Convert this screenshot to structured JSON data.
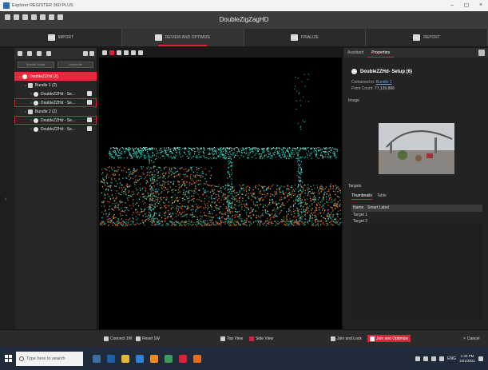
{
  "window": {
    "title": "Explorer REGISTER 360 PLUS",
    "min_label": "–",
    "max_label": "☐",
    "close_label": "×"
  },
  "header": {
    "doc_title": "DoubleZigZagHD"
  },
  "steps": [
    {
      "label": "IMPORT"
    },
    {
      "label": "REVIEW AND OPTIMIZE"
    },
    {
      "label": "FINALIZE"
    },
    {
      "label": "REPORT"
    }
  ],
  "project": {
    "btn_left": "Bundle Mode",
    "btn_right": "Unbundle",
    "tree": [
      {
        "label": "DoubleZZHd (2)",
        "level": 0,
        "type": "root",
        "selected": true
      },
      {
        "label": "Bundle 1 (2)",
        "level": 1,
        "type": "group"
      },
      {
        "label": "DoubleZZHd - Se... ",
        "level": 2,
        "type": "setup"
      },
      {
        "label": "DoubleZZHd - Se... ",
        "level": 2,
        "type": "setup",
        "outlined": true
      },
      {
        "label": "Bundle 2 (2)",
        "level": 1,
        "type": "group"
      },
      {
        "label": "DoubleZZHd - Se... ",
        "level": 2,
        "type": "setup",
        "outlined": true
      },
      {
        "label": "DoubleZZHd - Se... ",
        "level": 2,
        "type": "setup"
      }
    ]
  },
  "properties": {
    "tab_assistant": "Assistant",
    "tab_properties": "Properties",
    "setup_title": "DoubleZZHd- Setup (6)",
    "contained_in_label": "Contained in:",
    "contained_in_value": "Bundle 1",
    "point_count_label": "Point Count:",
    "point_count_value": "77,139,866",
    "image_label": "Image",
    "targets_label": "Targets",
    "targets_tabs": [
      "Thumbnails",
      "Table"
    ],
    "table_headers": [
      "Name",
      "Smart Label"
    ],
    "table_rows": [
      "Target 1",
      "Target 2"
    ]
  },
  "bottom_actions": {
    "connect": "Connect 1W",
    "reset": "Reset 1W",
    "top_view": "Top View",
    "side_view": "Side View",
    "join_lock": "Join and Lock",
    "visual_align": "Join and Optimize",
    "cancel": "Cancel"
  },
  "taskbar": {
    "search_placeholder": "Type here to search",
    "time": "1:40 PM",
    "date": "10/1/2021",
    "lang": "ENG"
  },
  "colors": {
    "accent": "#e0203a",
    "panel": "#262626",
    "viewport": "#000000"
  }
}
